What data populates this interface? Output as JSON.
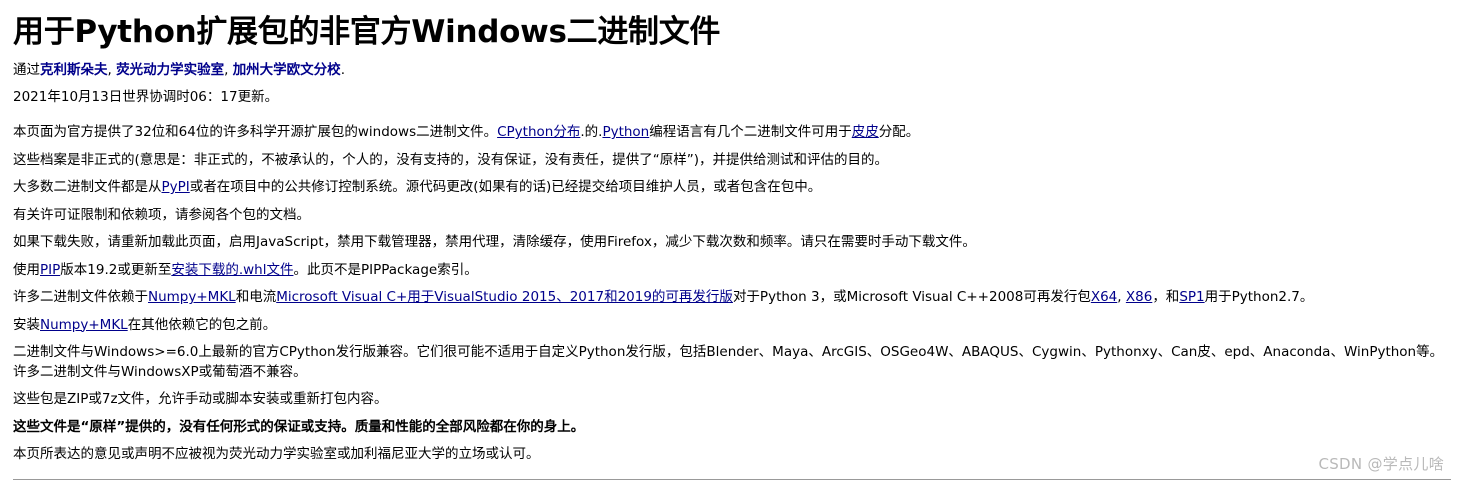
{
  "title": "用于Python扩展包的非官方Windows二进制文件",
  "authors": {
    "prefix": "通过",
    "author1": "克利斯朵夫",
    "sep1": ", ",
    "author2": "荧光动力学实验室",
    "sep2": ", ",
    "author3": "加州大学欧文分校",
    "suffix": "."
  },
  "updated": "2021年10月13日世界协调时06：17更新。",
  "p1": {
    "t1": "本页面为官方提供了32位和64位的许多科学开源扩展包的windows二进制文件。",
    "link1": "CPython分布",
    "t2": ".的.",
    "link2": "Python",
    "t3": "编程语言有几个二进制文件可用于",
    "link3": "皮皮",
    "t4": "分配。"
  },
  "p2": "这些档案是非正式的(意思是：非正式的，不被承认的，个人的，没有支持的，没有保证，没有责任，提供了“原样”)，并提供给测试和评估的目的。",
  "p3": {
    "t1": "大多数二进制文件都是从",
    "link1": "PyPI",
    "t2": "或者在项目中的公共修订控制系统。源代码更改(如果有的话)已经提交给项目维护人员，或者包含在包中。"
  },
  "p4": "有关许可证限制和依赖项，请参阅各个包的文档。",
  "p5": "如果下载失败，请重新加载此页面，启用JavaScript，禁用下载管理器，禁用代理，清除缓存，使用Firefox，减少下载次数和频率。请只在需要时手动下载文件。",
  "p6": {
    "t1": "使用",
    "link1": "PIP",
    "t2": "版本19.2或更新至",
    "link2": "安装下载的.whl文件",
    "t3": "。此页不是PIPPackage索引。"
  },
  "p7": {
    "t1": "许多二进制文件依赖于",
    "link1": "Numpy+MKL",
    "t2": "和电流",
    "link2": "Microsoft Visual C+用于VisualStudio 2015、2017和2019的可再发行版",
    "t3": "对于Python 3，或Microsoft Visual C++2008可再发行包",
    "link3": "X64",
    "t4": ", ",
    "link4": "X86",
    "t5": "，和",
    "link5": "SP1",
    "t6": "用于Python2.7。"
  },
  "p8": {
    "t1": "安装",
    "link1": "Numpy+MKL",
    "t2": "在其他依赖它的包之前。"
  },
  "p9": "二进制文件与Windows>=6.0上最新的官方CPython发行版兼容。它们很可能不适用于自定义Python发行版，包括Blender、Maya、ArcGIS、OSGeo4W、ABAQUS、Cygwin、Pythonxy、Can皮、epd、Anaconda、WinPython等。许多二进制文件与WindowsXP或葡萄酒不兼容。",
  "p10": "这些包是ZIP或7z文件，允许手动或脚本安装或重新打包内容。",
  "p11": "这些文件是“原样”提供的，没有任何形式的保证或支持。质量和性能的全部风险都在你的身上。",
  "p12": "本页所表达的意见或声明不应被视为荧光动力学实验室或加利福尼亚大学的立场或认可。",
  "watermark": "CSDN @学点儿啥",
  "colors": {
    "link": "#00008b",
    "watermark": "#b9b9b9",
    "rule": "#999999"
  }
}
